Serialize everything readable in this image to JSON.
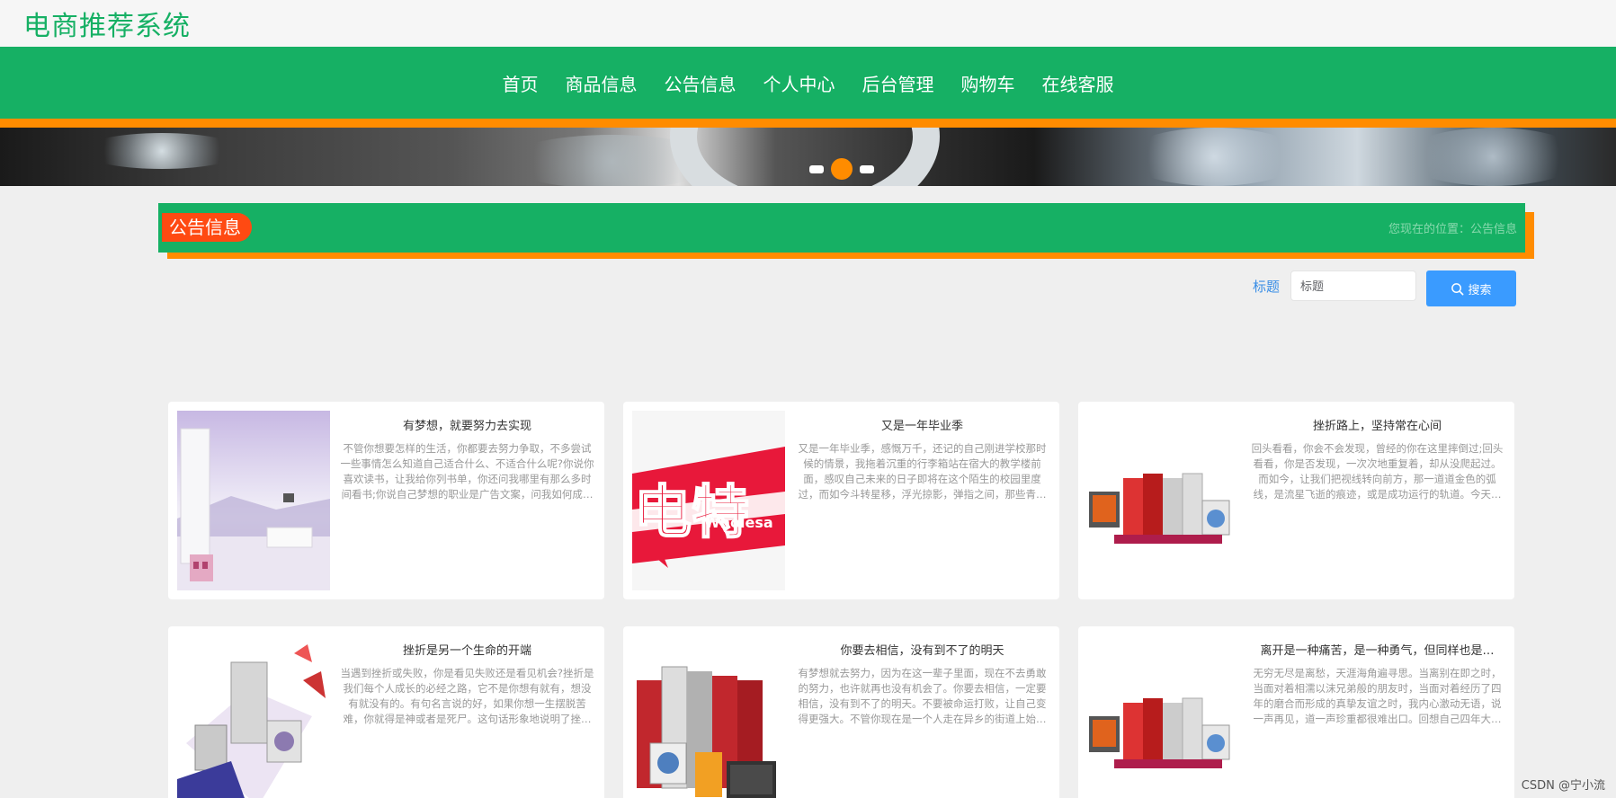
{
  "site": {
    "title": "电商推荐系统"
  },
  "nav": {
    "items": [
      {
        "label": "首页"
      },
      {
        "label": "商品信息"
      },
      {
        "label": "公告信息"
      },
      {
        "label": "个人中心"
      },
      {
        "label": "后台管理"
      },
      {
        "label": "购物车"
      },
      {
        "label": "在线客服"
      }
    ]
  },
  "section": {
    "title": "公告信息",
    "breadcrumb": "您现在的位置：公告信息"
  },
  "search": {
    "label": "标题",
    "placeholder": "标题",
    "button_label": "搜索"
  },
  "cards": [
    {
      "title": "有梦想，就要努力去实现",
      "desc": "不管你想要怎样的生活，你都要去努力争取，不多尝试一些事情怎么知道自己适合什么、不适合什么呢?你说你喜欢读书，让我给你列书单，你还问我哪里有那么多时间看书;你说自己梦想的职业是广告文案，问我如何成为一个文案，应该具备哪些素质;你说你计划…"
    },
    {
      "title": "又是一年毕业季",
      "desc": "又是一年毕业季，感慨万千，还记的自己刚进学校那时候的情景，我拖着沉重的行李箱站在宿大的教学楼前面，感叹自己未来的日子即将在这个陌生的校园里度过，而如今斗转星移，浮光掠影，弹指之间，那些青葱岁月如同白驹过隙般悄然从指缝溜走。过去的…"
    },
    {
      "title": "挫折路上，坚持常在心间",
      "desc": "回头看看，你会不会发现，曾经的你在这里摔倒过;回头看看，你是否发现，一次次地重复着，却从没爬起过。而如今，让我们把视线转向前方，那一道道金色的弧线，是流星飞逝的痕迹，或是成功运行的轨道。今天的你，是否要扬帆起航，让幸福来敲门?清晨的…"
    },
    {
      "title": "挫折是另一个生命的开端",
      "desc": "当遇到挫折或失败，你是看见失败还是看见机会?挫折是我们每个人成长的必经之路，它不是你想有就有，想没有就没有的。有句名言说的好，如果你想一生摆脱苦难，你就得是神或者是死尸。这句话形象地说明了挫折是伴随着人生的，是谁都逃不掉的。"
    },
    {
      "title": "你要去相信，没有到不了的明天",
      "desc": "有梦想就去努力，因为在这一辈子里面，现在不去勇敢的努力，也许就再也没有机会了。你要去相信，一定要相信，没有到不了的明天。不要被命运打败，让自己变得更强大。不管你现在是一个人走在异乡的街道上始终没有找到一丝归属感，还是你在跟朋友们…"
    },
    {
      "title": "离开是一种痛苦，是一种勇气，但同样也是…",
      "desc": "无穷无尽是离愁，天涯海角遍寻思。当离别在即之时，当面对着相濡以沫兄弟般的朋友时，当面对着经历了四年的磨合而形成的真挚友谊之时，我内心激动无语，说一声再见，道一声珍重都很难出口。回想自己四年大学的风风雨雨，回想我们曾经共同经历的…"
    }
  ],
  "watermark": "CSDN @宁小流"
}
